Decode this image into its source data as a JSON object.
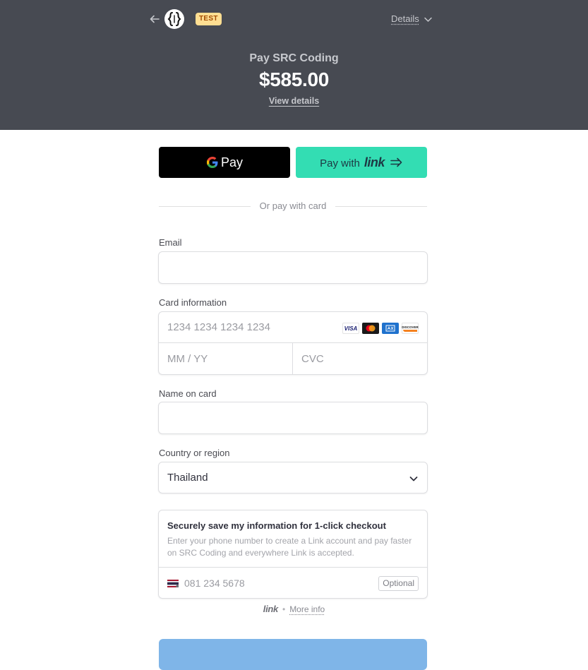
{
  "header": {
    "test_badge": "TEST",
    "details_label": "Details",
    "pay_to": "Pay SRC Coding",
    "amount": "$585.00",
    "view_details": "View details",
    "background_color": "#474a52"
  },
  "wallets": {
    "gpay_label": "Pay",
    "link_prefix": "Pay with",
    "link_brand": "link"
  },
  "divider_text": "Or pay with card",
  "form": {
    "email_label": "Email",
    "email_value": "",
    "card_label": "Card information",
    "card_number_placeholder": "1234 1234 1234 1234",
    "expiry_placeholder": "MM / YY",
    "cvc_placeholder": "CVC",
    "card_brands": [
      "VISA",
      "mastercard",
      "amex",
      "DISCOVER"
    ],
    "name_label": "Name on card",
    "name_value": "",
    "country_label": "Country or region",
    "country_value": "Thailand"
  },
  "save_info": {
    "title": "Securely save my information for 1-click checkout",
    "description": "Enter your phone number to create a Link account and pay faster on SRC Coding and everywhere Link is accepted.",
    "phone_placeholder": "081 234 5678",
    "optional_label": "Optional"
  },
  "footer": {
    "link_brand": "link",
    "separator": "•",
    "more_info": "More info"
  },
  "colors": {
    "link_green": "#33ddb3",
    "pay_button": "#7fb5e8",
    "test_badge_bg": "#ffde92"
  }
}
